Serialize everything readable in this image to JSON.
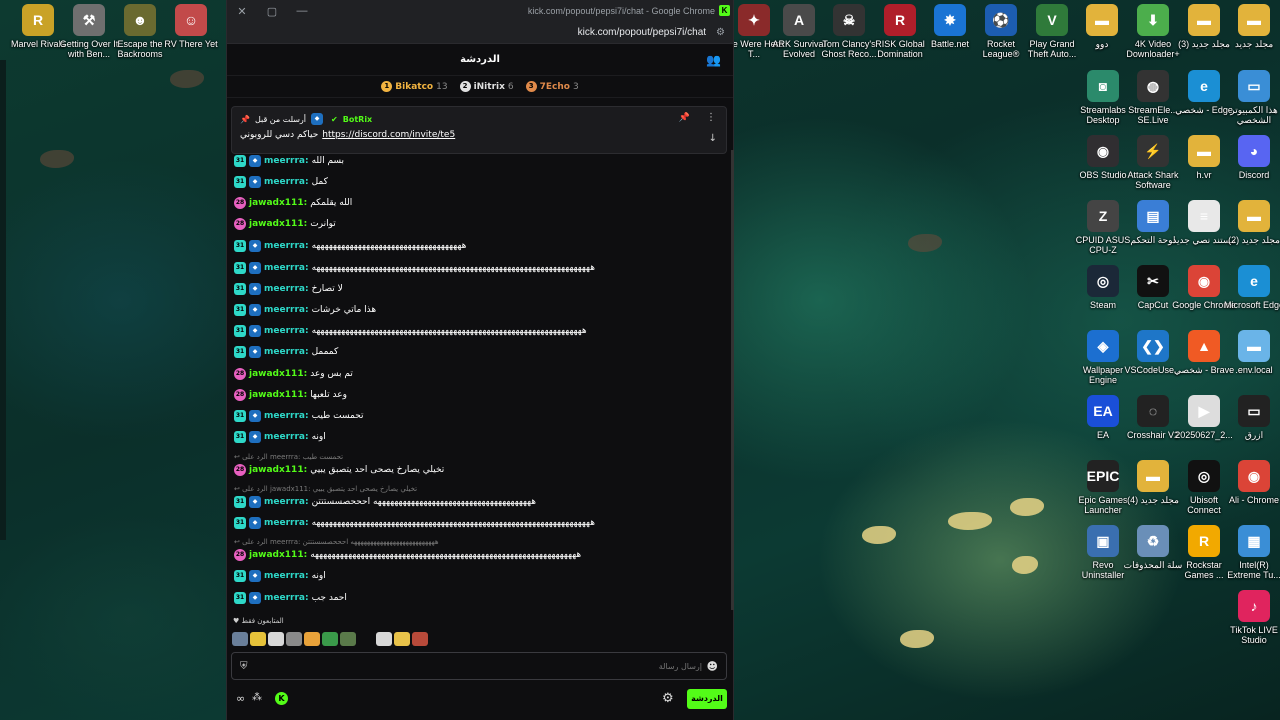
{
  "desktop_icons_left": [
    {
      "label": "Marvel Rivals",
      "glyph": "R",
      "color": "#c9a227"
    },
    {
      "label": "Getting Over It with Ben...",
      "glyph": "⚒",
      "color": "#6f6f6f"
    },
    {
      "label": "Escape the Backrooms",
      "glyph": "☻",
      "color": "#6a6a30"
    },
    {
      "label": "RV There Yet",
      "glyph": "☺",
      "color": "#c24a4a"
    }
  ],
  "desktop_icons_top": [
    {
      "label": "We Were Here T...",
      "glyph": "✦",
      "color": "#8a2a2a"
    },
    {
      "label": "ARK Survival Evolved",
      "glyph": "A",
      "color": "#4a4a4a"
    },
    {
      "label": "Tom Clancy's Ghost Reco...",
      "glyph": "☠",
      "color": "#333"
    },
    {
      "label": "RISK Global Domination",
      "glyph": "R",
      "color": "#b01e2a"
    },
    {
      "label": "Battle.net",
      "glyph": "✸",
      "color": "#1a74d4"
    },
    {
      "label": "Rocket League®",
      "glyph": "⚽",
      "color": "#1c5db0"
    },
    {
      "label": "Play Grand Theft Auto...",
      "glyph": "V",
      "color": "#2f7a3a"
    },
    {
      "label": "دوو",
      "glyph": "▬",
      "color": "#e2b33b"
    },
    {
      "label": "4K Video Downloader+",
      "glyph": "⬇",
      "color": "#4cae4c"
    },
    {
      "label": "مجلد جديد (3)",
      "glyph": "▬",
      "color": "#e2b33b"
    },
    {
      "label": "مجلد جديد",
      "glyph": "▬",
      "color": "#e2b33b"
    }
  ],
  "desktop_grid": [
    {
      "label": "Streamlabs Desktop",
      "glyph": "◙",
      "color": "#2b8a6b"
    },
    {
      "label": "StreamEle... SE.Live",
      "glyph": "◍",
      "color": "#333"
    },
    {
      "label": "شخصي - Edge",
      "glyph": "e",
      "color": "#1b8fd4"
    },
    {
      "label": "هذا الكمبيوتر الشخصي",
      "glyph": "▭",
      "color": "#3a8ed6"
    },
    {
      "label": "OBS Studio",
      "glyph": "◉",
      "color": "#302e31"
    },
    {
      "label": "Attack Shark Software",
      "glyph": "⚡",
      "color": "#333"
    },
    {
      "label": "h.vr",
      "glyph": "▬",
      "color": "#e2b33b"
    },
    {
      "label": "Discord",
      "glyph": "◕",
      "color": "#5865f2"
    },
    {
      "label": "CPUID ASUS CPU-Z",
      "glyph": "Z",
      "color": "#444"
    },
    {
      "label": "لوحة التحكم",
      "glyph": "▤",
      "color": "#3a7ed6"
    },
    {
      "label": "مستند نصي جديد",
      "glyph": "≡",
      "color": "#e8e8e8"
    },
    {
      "label": "مجلد جديد (2)",
      "glyph": "▬",
      "color": "#e2b33b"
    },
    {
      "label": "Steam",
      "glyph": "◎",
      "color": "#1b2838"
    },
    {
      "label": "CapCut",
      "glyph": "✂",
      "color": "#111"
    },
    {
      "label": "Google Chrome",
      "glyph": "◉",
      "color": "#db4437"
    },
    {
      "label": "Microsoft Edge",
      "glyph": "e",
      "color": "#1b8fd4"
    },
    {
      "label": "Wallpaper Engine",
      "glyph": "◈",
      "color": "#1c6fd0"
    },
    {
      "label": "VSCodeUse...",
      "glyph": "❮❯",
      "color": "#1e76c8"
    },
    {
      "label": "شخصي - Brave",
      "glyph": "▲",
      "color": "#f05a24"
    },
    {
      "label": ".env.local",
      "glyph": "▬",
      "color": "#6ab4e8"
    },
    {
      "label": "EA",
      "glyph": "EA",
      "color": "#1a4fd8"
    },
    {
      "label": "Crosshair V2",
      "glyph": "◌",
      "color": "#222"
    },
    {
      "label": "20250627_2...",
      "glyph": "▶",
      "color": "#ddd"
    },
    {
      "label": "ازرق",
      "glyph": "▭",
      "color": "#222"
    },
    {
      "label": "Epic Games Launcher",
      "glyph": "EPIC",
      "color": "#222"
    },
    {
      "label": "مجلد جديد (4)",
      "glyph": "▬",
      "color": "#e2b33b"
    },
    {
      "label": "Ubisoft Connect",
      "glyph": "◎",
      "color": "#111"
    },
    {
      "label": "Ali - Chrome",
      "glyph": "◉",
      "color": "#db4437"
    },
    {
      "label": "Revo Uninstaller",
      "glyph": "▣",
      "color": "#3a6fb0"
    },
    {
      "label": "سلة المحذوفات",
      "glyph": "♻",
      "color": "#6a8fb8"
    },
    {
      "label": "Rockstar Games ...",
      "glyph": "R",
      "color": "#f2a900"
    },
    {
      "label": "Intel(R) Extreme Tu...",
      "glyph": "▦",
      "color": "#3a8ed6"
    },
    {
      "label": "TikTok LIVE Studio",
      "glyph": "♪",
      "color": "#e0245e"
    }
  ],
  "window": {
    "title": "kick.com/popout/pepsi7i/chat - Google Chrome",
    "favicon": "K",
    "url": "kick.com/popout/pepsi7i/chat",
    "minimize": "—",
    "maximize": "▢",
    "close": "✕",
    "tune_icon": "⚙"
  },
  "chat": {
    "header_title": "الدردشة",
    "leaderboard": [
      {
        "rank": "1",
        "name": "Bikatco",
        "count": "13",
        "color": "#f2b441"
      },
      {
        "rank": "2",
        "name": "iNitrix",
        "count": "6",
        "color": "#e0e0e0"
      },
      {
        "rank": "3",
        "name": "7Echo",
        "count": "3",
        "color": "#e08a4a"
      }
    ],
    "pinned": {
      "sent_by_label": "أرسلت من قبل",
      "bot_name": "BotRix",
      "text": "حياكم دسي للروبوني",
      "link": "https://discord.com/invite/te5"
    },
    "messages": [
      {
        "user": "meerrra:",
        "text": "بسم الله",
        "badge": "31",
        "badge_type": "lvl31",
        "ucolor": "#2ed8c8",
        "has_kick": true
      },
      {
        "user": "meerrra:",
        "text": "كمل",
        "badge": "31",
        "badge_type": "lvl31",
        "ucolor": "#2ed8c8",
        "has_kick": true
      },
      {
        "user": "jawadx111:",
        "text": "الله يقلمكم",
        "badge": "28",
        "badge_type": "lvl28",
        "ucolor": "#53fc18",
        "has_kick": false
      },
      {
        "user": "jawadx111:",
        "text": "توانرت",
        "badge": "28",
        "badge_type": "lvl28",
        "ucolor": "#53fc18",
        "has_kick": false
      },
      {
        "user": "meerrra:",
        "text": "ههههههههههههههههههههههههههههههههههههه",
        "badge": "31",
        "badge_type": "lvl31",
        "ucolor": "#2ed8c8",
        "has_kick": true
      },
      {
        "user": "meerrra:",
        "text": "هههههههههههههههههههههههههههههههههههههههههههههههههههههههههههههههههههه",
        "badge": "31",
        "badge_type": "lvl31",
        "ucolor": "#2ed8c8",
        "has_kick": true
      },
      {
        "user": "meerrra:",
        "text": "لا تصارخ",
        "badge": "31",
        "badge_type": "lvl31",
        "ucolor": "#2ed8c8",
        "has_kick": true
      },
      {
        "user": "meerrra:",
        "text": "هذا ماتي خرشات",
        "badge": "31",
        "badge_type": "lvl31",
        "ucolor": "#2ed8c8",
        "has_kick": true
      },
      {
        "user": "meerrra:",
        "text": "هههههههههههههههههههههههههههههههههههههههههههههههههههههههههههههههههه",
        "badge": "31",
        "badge_type": "lvl31",
        "ucolor": "#2ed8c8",
        "has_kick": true
      },
      {
        "user": "meerrra:",
        "text": "كمممل",
        "badge": "31",
        "badge_type": "lvl31",
        "ucolor": "#2ed8c8",
        "has_kick": true
      },
      {
        "user": "jawadx111:",
        "text": "تم بس وعد",
        "badge": "28",
        "badge_type": "lvl28",
        "ucolor": "#53fc18",
        "has_kick": false
      },
      {
        "user": "jawadx111:",
        "text": "وعد تلعبها",
        "badge": "28",
        "badge_type": "lvl28",
        "ucolor": "#53fc18",
        "has_kick": false
      },
      {
        "user": "meerrra:",
        "text": "تحمست طيب",
        "badge": "31",
        "badge_type": "lvl31",
        "ucolor": "#2ed8c8",
        "has_kick": true
      },
      {
        "user": "meerrra:",
        "text": "اونه",
        "badge": "31",
        "badge_type": "lvl31",
        "ucolor": "#2ed8c8",
        "has_kick": true
      },
      {
        "user": "jawadx111:",
        "text": "تخيلي يصارخ يصحى احد يتصبق يبيي",
        "badge": "28",
        "badge_type": "lvl28",
        "ucolor": "#53fc18",
        "has_kick": false
      },
      {
        "user": "meerrra:",
        "text": "ههههههههههههههههههههههههههههههههههههههه احححصسستتتن",
        "badge": "31",
        "badge_type": "lvl31",
        "ucolor": "#2ed8c8",
        "has_kick": true
      },
      {
        "user": "meerrra:",
        "text": "هههههههههههههههههههههههههههههههههههههههههههههههههههههههههههههههههههه",
        "badge": "31",
        "badge_type": "lvl31",
        "ucolor": "#2ed8c8",
        "has_kick": true
      },
      {
        "user": "jawadx111:",
        "text": "ههههههههههههههههههههههههههههههههههههههههههههههههههههههههههههههههه",
        "badge": "28",
        "badge_type": "lvl28",
        "ucolor": "#53fc18",
        "has_kick": false
      },
      {
        "user": "meerrra:",
        "text": "اونه",
        "badge": "31",
        "badge_type": "lvl31",
        "ucolor": "#2ed8c8",
        "has_kick": true
      },
      {
        "user": "meerrra:",
        "text": "احمد جب",
        "badge": "31",
        "badge_type": "lvl31",
        "ucolor": "#2ed8c8",
        "has_kick": true
      }
    ],
    "replies": [
      {
        "text": "↩ الرد على meerrra: تحمست طيب",
        "before_index": 14
      },
      {
        "text": "↩ الرد على jawadx111: تخيلي يصارخ يصحى احد يتصبق يبيي",
        "before_index": 15
      },
      {
        "text": "↩ الرد على meerrra: ههههههههههههههههههههههههههه احححصسستتتن",
        "before_index": 17
      }
    ],
    "followers_only_label": "♥ المتابعون فقط",
    "emotes": [
      "#6a7f9a",
      "#e6c23a",
      "#d8d8d8",
      "#8a8a8a",
      "#e8a23a",
      "#3a9a4a",
      "#5a7a4a",
      "#d8d8d8",
      "#e8c24a",
      "#b84a3a"
    ],
    "input_placeholder": "إرسال رسالة",
    "send_button": "الدردشة",
    "footer_infinity": "∞",
    "footer_dots": "⁂",
    "footer_kick": "K"
  }
}
